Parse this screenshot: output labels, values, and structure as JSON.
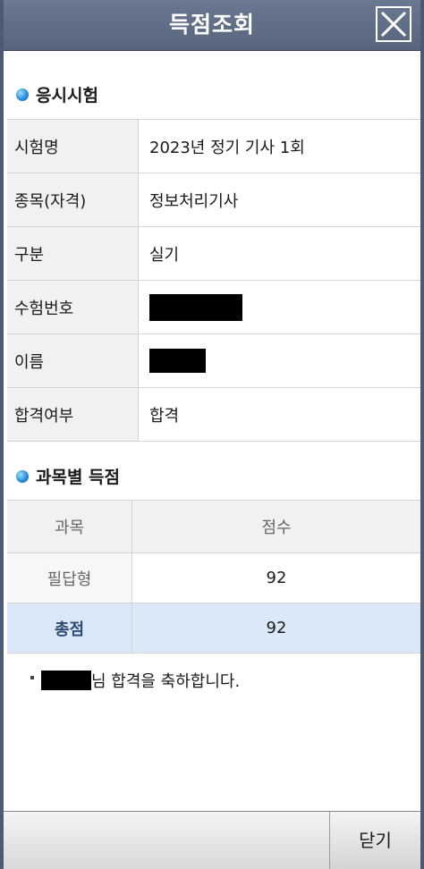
{
  "dialog": {
    "title": "득점조회",
    "close_icon": "close-icon"
  },
  "exam_section": {
    "heading": "응시시험",
    "rows": [
      {
        "label": "시험명",
        "value": "2023년 정기 기사 1회"
      },
      {
        "label": "종목(자격)",
        "value": "정보처리기사"
      },
      {
        "label": "구분",
        "value": "실기"
      },
      {
        "label": "수험번호",
        "value": "",
        "redacted": true
      },
      {
        "label": "이름",
        "value": "",
        "redacted": true
      },
      {
        "label": "합격여부",
        "value": "합격"
      }
    ]
  },
  "score_section": {
    "heading": "과목별 득점",
    "columns": [
      "과목",
      "점수"
    ],
    "rows": [
      {
        "subject": "필답형",
        "score": "92"
      }
    ],
    "total": {
      "label": "총점",
      "score": "92"
    }
  },
  "message": {
    "suffix": "님 합격을 축하합니다."
  },
  "footer": {
    "close_label": "닫기"
  },
  "colors": {
    "titlebar": "#5f6d85",
    "accent_bullet": "#2a8fd8",
    "total_row_bg": "#dbe8f8"
  }
}
